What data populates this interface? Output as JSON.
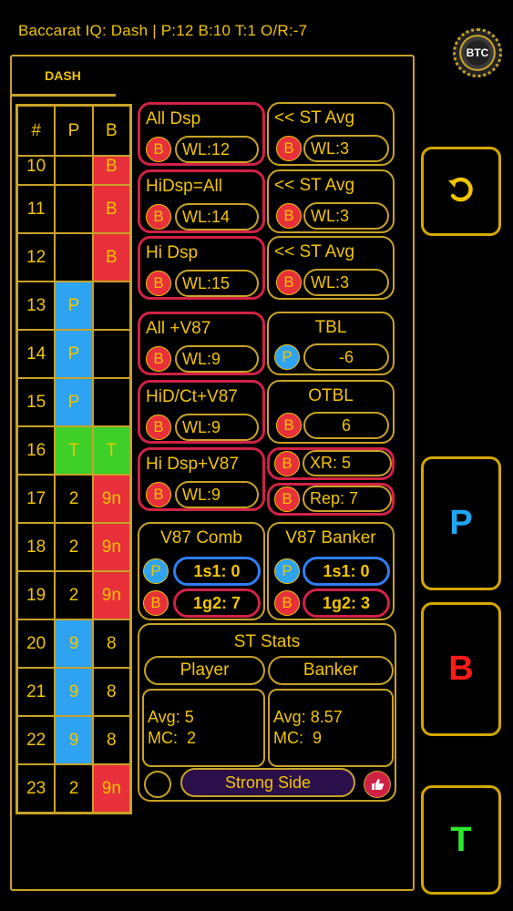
{
  "header": {
    "title": "Baccarat IQ: Dash | P:12  B:10  T:1  O/R:-7"
  },
  "logo": {
    "text": "BTC"
  },
  "tab": {
    "label": "DASH"
  },
  "road": {
    "columns": [
      "#",
      "P",
      "B"
    ],
    "rows": [
      {
        "n": "10",
        "p": "",
        "b": "B",
        "pc": "",
        "bc": "b",
        "partial": true
      },
      {
        "n": "11",
        "p": "",
        "b": "B",
        "pc": "",
        "bc": "b"
      },
      {
        "n": "12",
        "p": "",
        "b": "B",
        "pc": "",
        "bc": "b"
      },
      {
        "n": "13",
        "p": "P",
        "b": "",
        "pc": "p",
        "bc": ""
      },
      {
        "n": "14",
        "p": "P",
        "b": "",
        "pc": "p",
        "bc": ""
      },
      {
        "n": "15",
        "p": "P",
        "b": "",
        "pc": "p",
        "bc": ""
      },
      {
        "n": "16",
        "p": "T",
        "b": "T",
        "pc": "t",
        "bc": "t"
      },
      {
        "n": "17",
        "p": "2",
        "b": "9n",
        "pc": "",
        "bc": "b"
      },
      {
        "n": "18",
        "p": "2",
        "b": "9n",
        "pc": "",
        "bc": "b"
      },
      {
        "n": "19",
        "p": "2",
        "b": "9n",
        "pc": "",
        "bc": "b"
      },
      {
        "n": "20",
        "p": "9",
        "b": "8",
        "pc": "p",
        "bc": ""
      },
      {
        "n": "21",
        "p": "9",
        "b": "8",
        "pc": "p",
        "bc": ""
      },
      {
        "n": "22",
        "p": "9",
        "b": "8",
        "pc": "p",
        "bc": ""
      },
      {
        "n": "23",
        "p": "2",
        "b": "9n",
        "pc": "",
        "bc": "b"
      }
    ]
  },
  "cards": {
    "all_dsp": {
      "title": "All Dsp",
      "badge": "B",
      "value": "WL:12"
    },
    "st_avg_1": {
      "title": "<< ST Avg",
      "badge": "B",
      "value": "WL:3"
    },
    "hidsp_all": {
      "title": "HiDsp=All",
      "badge": "B",
      "value": "WL:14"
    },
    "st_avg_2": {
      "title": "<< ST Avg",
      "badge": "B",
      "value": "WL:3"
    },
    "hi_dsp": {
      "title": "Hi Dsp",
      "badge": "B",
      "value": "WL:15"
    },
    "st_avg_3": {
      "title": "<< ST Avg",
      "badge": "B",
      "value": "WL:3"
    },
    "all_v87": {
      "title": "All +V87",
      "badge": "B",
      "value": "WL:9"
    },
    "tbl": {
      "title": "TBL",
      "badge": "P",
      "value": "-6"
    },
    "hid_ct_v87": {
      "title": "HiD/Ct+V87",
      "badge": "B",
      "value": "WL:9"
    },
    "otbl": {
      "title": "OTBL",
      "badge": "B",
      "value": "6"
    },
    "hi_dsp_v87": {
      "title": "Hi Dsp+V87",
      "badge": "B",
      "value": "WL:9"
    },
    "xr": {
      "badge": "B",
      "value": "XR: 5"
    },
    "rep": {
      "badge": "B",
      "value": "Rep: 7"
    },
    "v87_comb": {
      "title": "V87 Comb",
      "p_badge": "P",
      "p_value": "1s1: 0",
      "b_badge": "B",
      "b_value": "1g2: 7"
    },
    "v87_banker": {
      "title": "V87 Banker",
      "p_badge": "P",
      "p_value": "1s1: 0",
      "b_badge": "B",
      "b_value": "1g2: 3"
    }
  },
  "st_stats": {
    "title": "ST Stats",
    "player_label": "Player",
    "banker_label": "Banker",
    "player_text": "Avg: 5\nMC:  2",
    "banker_text": "Avg: 8.57\nMC:  9",
    "strong_side_label": "Strong Side",
    "thumb_icon": "thumbs-up-icon"
  },
  "side_buttons": {
    "undo_icon": "undo-icon",
    "player": "P",
    "banker": "B",
    "tie": "T",
    "colors": {
      "player": "#1ea6f0",
      "banker": "#ff1a1a",
      "tie": "#2ee82e"
    }
  }
}
